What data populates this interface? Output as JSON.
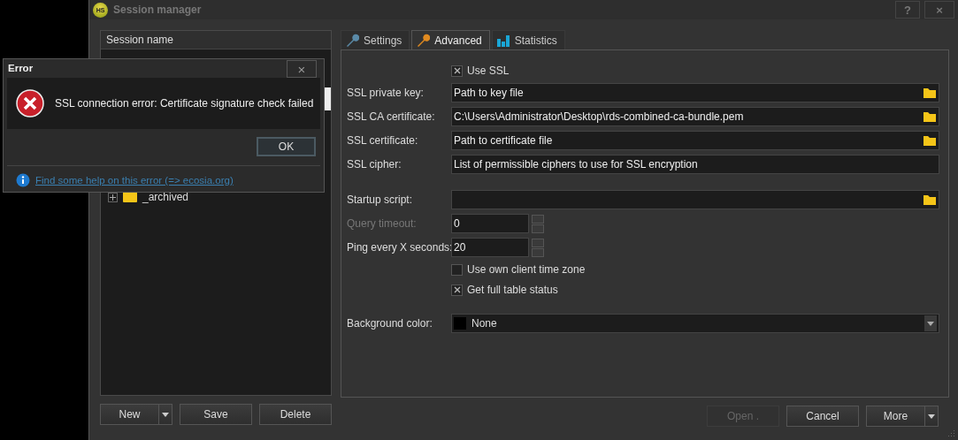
{
  "window": {
    "icon_text": "HS",
    "title": "Session manager",
    "help": "?",
    "close": "×"
  },
  "sessions": {
    "header": "Session name",
    "items": [
      {
        "name": "_archived",
        "expanded": false
      }
    ]
  },
  "tabs": [
    {
      "label": "Settings",
      "selected": false
    },
    {
      "label": "Advanced",
      "selected": true
    },
    {
      "label": "Statistics",
      "selected": false
    }
  ],
  "sections": [
    {
      "rows": [
        {
          "kind": "checkbox",
          "label": "Use SSL",
          "checked": true
        },
        {
          "kind": "file",
          "label": "SSL private key:",
          "placeholder": "Path to key file"
        },
        {
          "kind": "file",
          "label": "SSL CA certificate:",
          "value": "C:\\Users\\Administrator\\Desktop\\rds-combined-ca-bundle.pem"
        },
        {
          "kind": "file",
          "label": "SSL certificate:",
          "placeholder": "Path to certificate file"
        },
        {
          "kind": "text",
          "label": "SSL cipher:",
          "placeholder": "List of permissible ciphers to use for SSL encryption"
        }
      ]
    },
    {
      "rows": [
        {
          "kind": "file",
          "label": "Startup script:"
        },
        {
          "kind": "spinner",
          "label": "Query timeout:",
          "value": "0",
          "disabled": true
        },
        {
          "kind": "spinner",
          "label": "Ping every X seconds:",
          "value": "20",
          "disabled": false
        },
        {
          "kind": "checkbox",
          "label": "Use own client time zone",
          "checked": false
        },
        {
          "kind": "checkbox",
          "label": "Get full table status",
          "checked": true
        }
      ]
    },
    {
      "rows": [
        {
          "kind": "color",
          "label": "Background color:",
          "value": "None",
          "color": "#000000"
        }
      ]
    }
  ],
  "left_buttons": [
    {
      "label": "New",
      "dropdown": true,
      "disabled": false
    },
    {
      "label": "Save",
      "dropdown": false,
      "disabled": false
    },
    {
      "label": "Delete",
      "dropdown": false,
      "disabled": false
    }
  ],
  "right_buttons": [
    {
      "label": "Open .",
      "dropdown": false,
      "disabled": true
    },
    {
      "label": "Cancel",
      "dropdown": false,
      "disabled": false
    },
    {
      "label": "More",
      "dropdown": true,
      "disabled": false
    }
  ],
  "error_dialog": {
    "title": "Error",
    "close": "×",
    "message": "SSL connection error: Certificate signature check failed",
    "ok": "OK",
    "help_link": "Find some help on this error (=> ecosia.org)"
  }
}
